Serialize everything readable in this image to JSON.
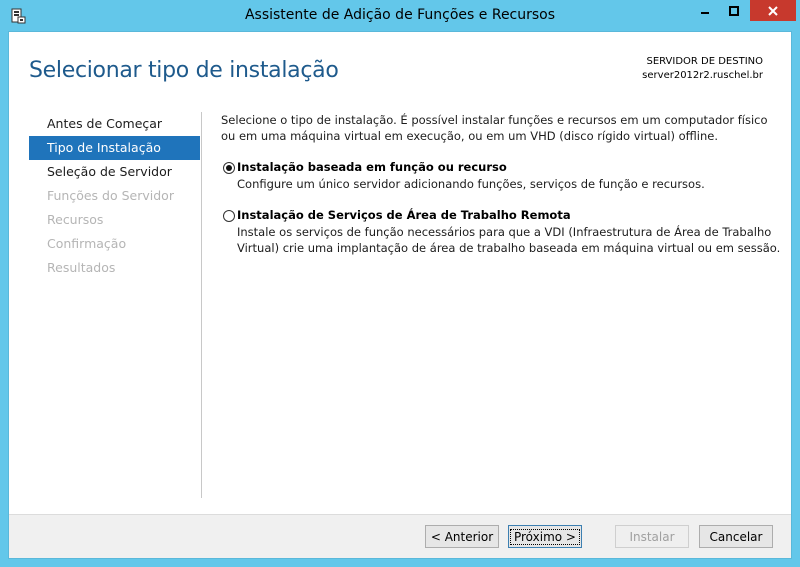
{
  "window": {
    "title": "Assistente de Adição de Funções e Recursos"
  },
  "header": {
    "page_title": "Selecionar tipo de instalação",
    "destination_label": "SERVIDOR DE DESTINO",
    "destination_server": "server2012r2.ruschel.br"
  },
  "nav": {
    "items": [
      {
        "label": "Antes de Começar",
        "state": "normal"
      },
      {
        "label": "Tipo de Instalação",
        "state": "active"
      },
      {
        "label": "Seleção de Servidor",
        "state": "normal"
      },
      {
        "label": "Funções do Servidor",
        "state": "disabled"
      },
      {
        "label": "Recursos",
        "state": "disabled"
      },
      {
        "label": "Confirmação",
        "state": "disabled"
      },
      {
        "label": "Resultados",
        "state": "disabled"
      }
    ]
  },
  "main": {
    "intro": "Selecione o tipo de instalação. É possível instalar funções e recursos em um computador físico ou em uma máquina virtual em execução, ou em um VHD (disco rígido virtual) offline.",
    "options": [
      {
        "title": "Instalação baseada em função ou recurso",
        "description": "Configure um único servidor adicionando funções, serviços de função e recursos.",
        "selected": true
      },
      {
        "title": "Instalação de Serviços de Área de Trabalho Remota",
        "description": "Instale os serviços de função necessários para que a VDI (Infraestrutura de Área de Trabalho Virtual) crie uma implantação de área de trabalho baseada em máquina virtual ou em sessão.",
        "selected": false
      }
    ]
  },
  "footer": {
    "prev_label": "< Anterior",
    "next_label": "Próximo >",
    "install_label": "Instalar",
    "cancel_label": "Cancelar"
  },
  "colors": {
    "frame": "#63c7ea",
    "title_accent": "#1e5a8c",
    "nav_active": "#1f74bb",
    "close_button": "#c7392d"
  }
}
